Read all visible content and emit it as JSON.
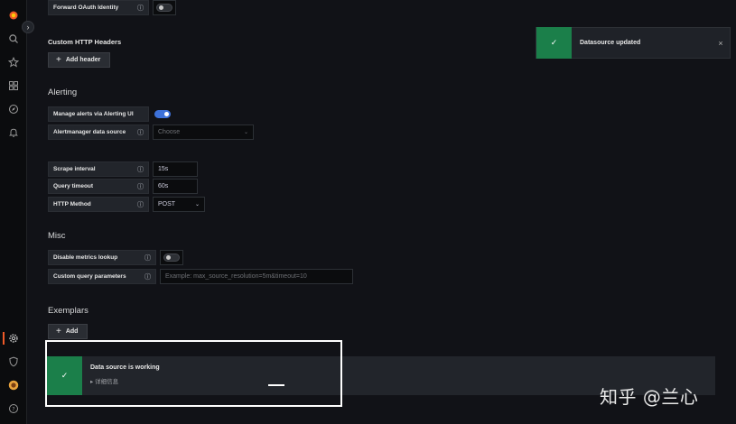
{
  "sidebar": {
    "expand_icon": "›",
    "icons": [
      "grafana-logo",
      "search-icon",
      "star-icon",
      "dashboards-icon",
      "explore-icon",
      "alerting-bell-icon",
      "gear-icon",
      "shield-icon",
      "avatar",
      "help-icon"
    ]
  },
  "auth": {
    "forward_oauth_label": "Forward OAuth Identity"
  },
  "custom_headers": {
    "title": "Custom HTTP Headers",
    "add_button": "Add header"
  },
  "alerting": {
    "title": "Alerting",
    "manage_alerts_label": "Manage alerts via Alerting UI",
    "alertmanager_label": "Alertmanager data source",
    "alertmanager_value": "Choose"
  },
  "settings": {
    "scrape_interval_label": "Scrape interval",
    "scrape_interval_value": "15s",
    "query_timeout_label": "Query timeout",
    "query_timeout_value": "60s",
    "http_method_label": "HTTP Method",
    "http_method_value": "POST"
  },
  "misc": {
    "title": "Misc",
    "disable_metrics_label": "Disable metrics lookup",
    "custom_query_label": "Custom query parameters",
    "custom_query_placeholder": "Example: max_source_resolution=5m&timeout=10"
  },
  "exemplars": {
    "title": "Exemplars",
    "add_button": "Add"
  },
  "toast": {
    "message": "Datasource updated",
    "close": "×"
  },
  "health": {
    "title": "Data source is working",
    "details": "▸ 详细信息"
  },
  "watermark": "知乎 @兰心",
  "colors": {
    "success": "#1b7f4a",
    "toggle_on": "#3d71d9",
    "accent": "#f05a28"
  }
}
